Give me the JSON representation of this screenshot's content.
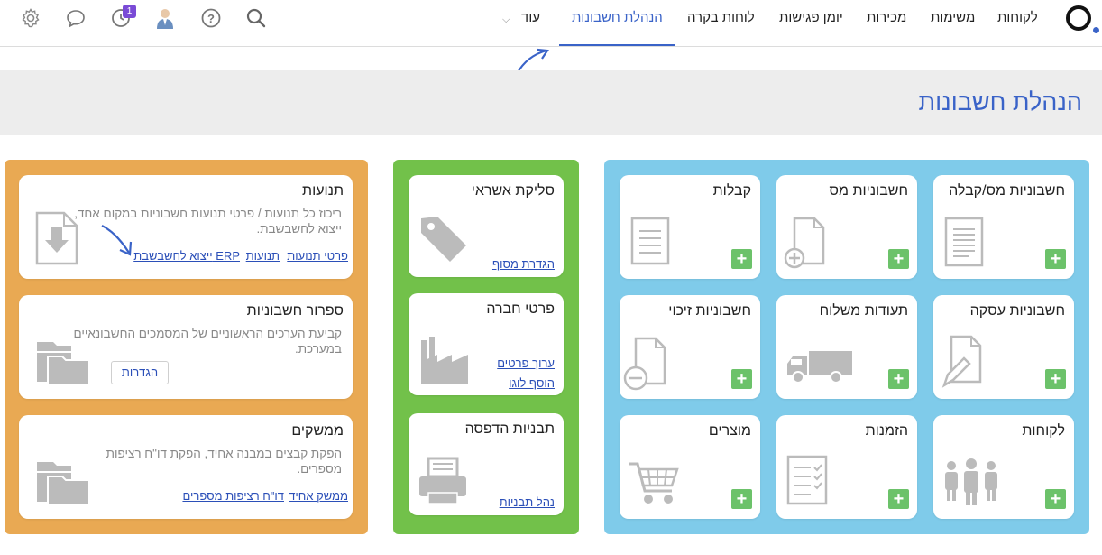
{
  "nav": {
    "items": [
      "לקוחות",
      "משימות",
      "מכירות",
      "יומן פגישות",
      "לוחות בקרה",
      "הנהלת חשבונות",
      "עוד"
    ],
    "notification_count": "1",
    "icons": [
      "logo",
      "search-icon",
      "help-icon",
      "user-avatar",
      "clock-icon",
      "chat-icon",
      "gear-icon",
      "chevron-down-icon"
    ]
  },
  "page": {
    "title": "הנהלת חשבונות"
  },
  "documents": {
    "invoice_receipt": "חשבוניות מס/קבלה",
    "tax_invoice": "חשבוניות מס",
    "receipts": "קבלות",
    "deal_invoice": "חשבוניות עסקה",
    "delivery_notes": "תעודות משלוח",
    "credit_invoice": "חשבוניות זיכוי",
    "customers": "לקוחות",
    "orders": "הזמנות",
    "products": "מוצרים",
    "add_symbol": "+"
  },
  "settings": {
    "clearing": {
      "title": "סליקת אשראי",
      "link": "הגדרת מסוף"
    },
    "company": {
      "title": "פרטי חברה",
      "link1": "ערוך פרטים",
      "link2": "הוסף לוגו"
    },
    "templates": {
      "title": "תבניות הדפסה",
      "link": "נהל תבניות"
    }
  },
  "accounting": {
    "transactions": {
      "title": "תנועות",
      "desc": "ריכוז כל תנועות / פרטי תנועות חשבוניות במקום אחד, ייצוא לחשבשבת.",
      "link_details": "פרטי תנועות",
      "link_transactions": "תנועות",
      "link_export": "ייצוא לחשבשבת ERP"
    },
    "numbering": {
      "title": "ספרור חשבוניות",
      "desc": "קביעת הערכים הראשוניים של המסמכים החשבונאיים במערכת.",
      "button": "הגדרות"
    },
    "interfaces": {
      "title": "ממשקים",
      "desc": "הפקת קבצים במבנה אחיד, הפקת דו\"ח רציפות מספרים.",
      "link1": "ממשק אחיד",
      "link2": "דו\"ח רציפות מספרים"
    }
  },
  "colors": {
    "accent": "#3a63c8",
    "blue_panel": "#7fcbea",
    "green_panel": "#72c14a",
    "orange_panel": "#e9a953",
    "plus": "#6cc26a"
  }
}
